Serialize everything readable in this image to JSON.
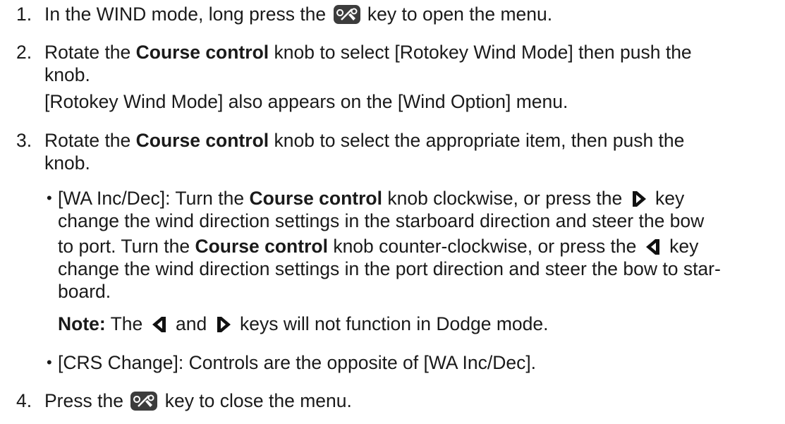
{
  "colors": {
    "text": "#1a1a1a",
    "key_fill": "#3c3c3c"
  },
  "icons": {
    "menu_key": "menu-settings-key-icon",
    "right_key": "right-arrow-key-icon",
    "left_key": "left-arrow-key-icon"
  },
  "steps": [
    {
      "number": "1.",
      "text_a": "In the WIND mode, long press the",
      "text_b": "key to open the menu."
    },
    {
      "number": "2.",
      "text_a": "Rotate the",
      "bold": "Course control",
      "text_b": "knob to select [Rotokey Wind Mode] then push the",
      "text_c": "knob.",
      "text_d": "[Rotokey Wind Mode] also appears on the [Wind Option] menu."
    },
    {
      "number": "3.",
      "text_a": "Rotate the",
      "bold": "Course control",
      "text_b": "knob to select the appropriate item, then push the",
      "text_c": "knob."
    },
    {
      "number": "4.",
      "text_a": "Press the",
      "text_b": "key to close the menu."
    }
  ],
  "bullet_wa": {
    "marker": "•",
    "l1_a": "[WA Inc/Dec]: Turn the",
    "l1_bold": "Course control",
    "l1_b": "knob clockwise, or press the",
    "l1_c": "key",
    "l2": "change the wind direction settings in the starboard direction and steer the bow",
    "l3_a": "to port. Turn the",
    "l3_bold": "Course control",
    "l3_b": "knob counter-clockwise, or press the",
    "l3_c": "key",
    "l4": "change the wind direction settings in the port direction and steer the bow to star-",
    "l5": "board."
  },
  "note": {
    "label": "Note:",
    "text_a": "The",
    "text_b": "and",
    "text_c": "keys will not function in Dodge mode."
  },
  "bullet_crs": {
    "marker": "•",
    "text": "[CRS Change]: Controls are the opposite of [WA Inc/Dec]."
  }
}
